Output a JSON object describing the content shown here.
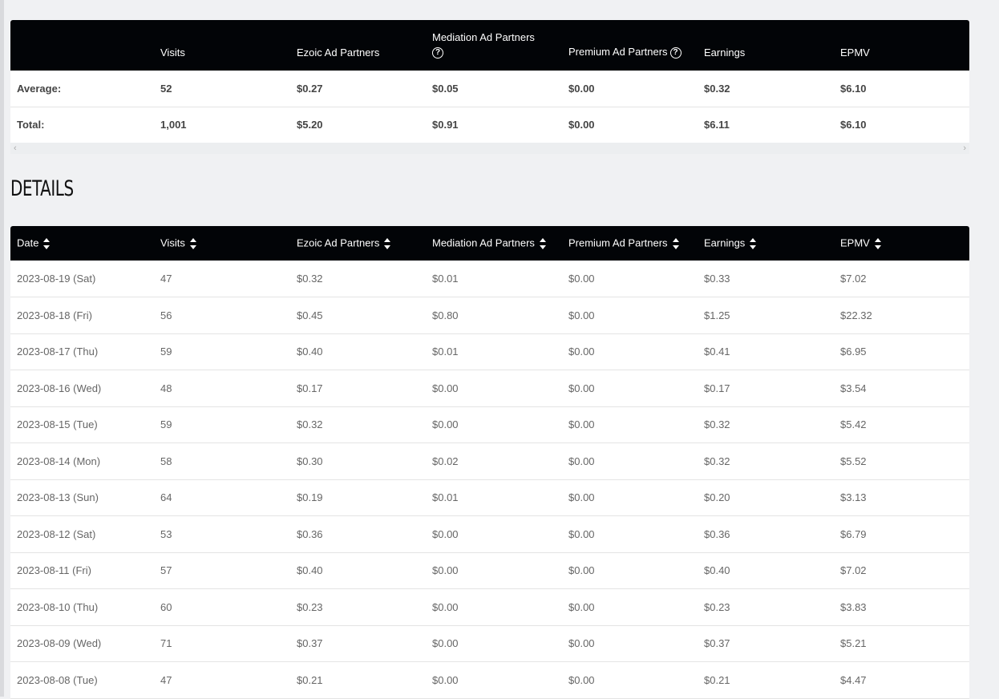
{
  "summary": {
    "columns": [
      "",
      "Visits",
      "Ezoic Ad Partners",
      "Mediation Ad Partners",
      "Premium Ad Partners",
      "Earnings",
      "EPMV"
    ],
    "help_icon": "question-circle-icon",
    "rows": [
      [
        "Average:",
        "52",
        "$0.27",
        "$0.05",
        "$0.00",
        "$0.32",
        "$6.10"
      ],
      [
        "Total:",
        "1,001",
        "$5.20",
        "$0.91",
        "$0.00",
        "$6.11",
        "$6.10"
      ]
    ]
  },
  "scrollbar": {
    "left_arrow": "‹",
    "right_arrow": "›"
  },
  "details": {
    "title": "DETAILS",
    "columns": [
      "Date",
      "Visits",
      "Ezoic Ad Partners",
      "Mediation Ad Partners",
      "Premium Ad Partners",
      "Earnings",
      "EPMV"
    ],
    "sort_icon": "sort-icon",
    "rows": [
      [
        "2023-08-19 (Sat)",
        "47",
        "$0.32",
        "$0.01",
        "$0.00",
        "$0.33",
        "$7.02"
      ],
      [
        "2023-08-18 (Fri)",
        "56",
        "$0.45",
        "$0.80",
        "$0.00",
        "$1.25",
        "$22.32"
      ],
      [
        "2023-08-17 (Thu)",
        "59",
        "$0.40",
        "$0.01",
        "$0.00",
        "$0.41",
        "$6.95"
      ],
      [
        "2023-08-16 (Wed)",
        "48",
        "$0.17",
        "$0.00",
        "$0.00",
        "$0.17",
        "$3.54"
      ],
      [
        "2023-08-15 (Tue)",
        "59",
        "$0.32",
        "$0.00",
        "$0.00",
        "$0.32",
        "$5.42"
      ],
      [
        "2023-08-14 (Mon)",
        "58",
        "$0.30",
        "$0.02",
        "$0.00",
        "$0.32",
        "$5.52"
      ],
      [
        "2023-08-13 (Sun)",
        "64",
        "$0.19",
        "$0.01",
        "$0.00",
        "$0.20",
        "$3.13"
      ],
      [
        "2023-08-12 (Sat)",
        "53",
        "$0.36",
        "$0.00",
        "$0.00",
        "$0.36",
        "$6.79"
      ],
      [
        "2023-08-11 (Fri)",
        "57",
        "$0.40",
        "$0.00",
        "$0.00",
        "$0.40",
        "$7.02"
      ],
      [
        "2023-08-10 (Thu)",
        "60",
        "$0.23",
        "$0.00",
        "$0.00",
        "$0.23",
        "$3.83"
      ],
      [
        "2023-08-09 (Wed)",
        "71",
        "$0.37",
        "$0.00",
        "$0.00",
        "$0.37",
        "$5.21"
      ],
      [
        "2023-08-08 (Tue)",
        "47",
        "$0.21",
        "$0.00",
        "$0.00",
        "$0.21",
        "$4.47"
      ]
    ]
  }
}
